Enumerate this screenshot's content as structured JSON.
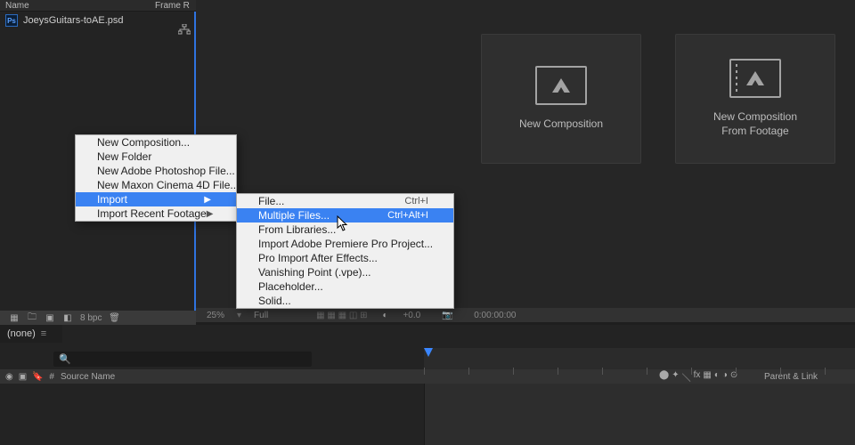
{
  "project": {
    "col_name": "Name",
    "col_right": "Frame R",
    "file": "JoeysGuitars-toAE.psd",
    "bpc": "8 bpc"
  },
  "viewer": {
    "btn1": "New Composition",
    "btn2_line1": "New Composition",
    "btn2_line2": "From Footage",
    "zoom": "25%",
    "res": "Full",
    "time_readout": "+0.0",
    "timecode": "0:00:00:00"
  },
  "timeline": {
    "tab": "(none)",
    "search_placeholder": "",
    "col_source": "Source Name",
    "col_parent": "Parent & Link"
  },
  "context_menu": {
    "items": [
      {
        "label": "New Composition..."
      },
      {
        "label": "New Folder"
      },
      {
        "label": "New Adobe Photoshop File..."
      },
      {
        "label": "New Maxon Cinema 4D File..."
      },
      {
        "label": "Import",
        "submenu": true,
        "highlight": true
      },
      {
        "label": "Import Recent Footage",
        "submenu": true
      }
    ],
    "submenu": [
      {
        "label": "File...",
        "shortcut": "Ctrl+I"
      },
      {
        "label": "Multiple Files...",
        "shortcut": "Ctrl+Alt+I",
        "highlight": true
      },
      {
        "label": "From Libraries..."
      },
      {
        "label": "Import Adobe Premiere Pro Project..."
      },
      {
        "label": "Pro Import After Effects..."
      },
      {
        "label": "Vanishing Point (.vpe)..."
      },
      {
        "label": "Placeholder..."
      },
      {
        "label": "Solid..."
      }
    ]
  }
}
